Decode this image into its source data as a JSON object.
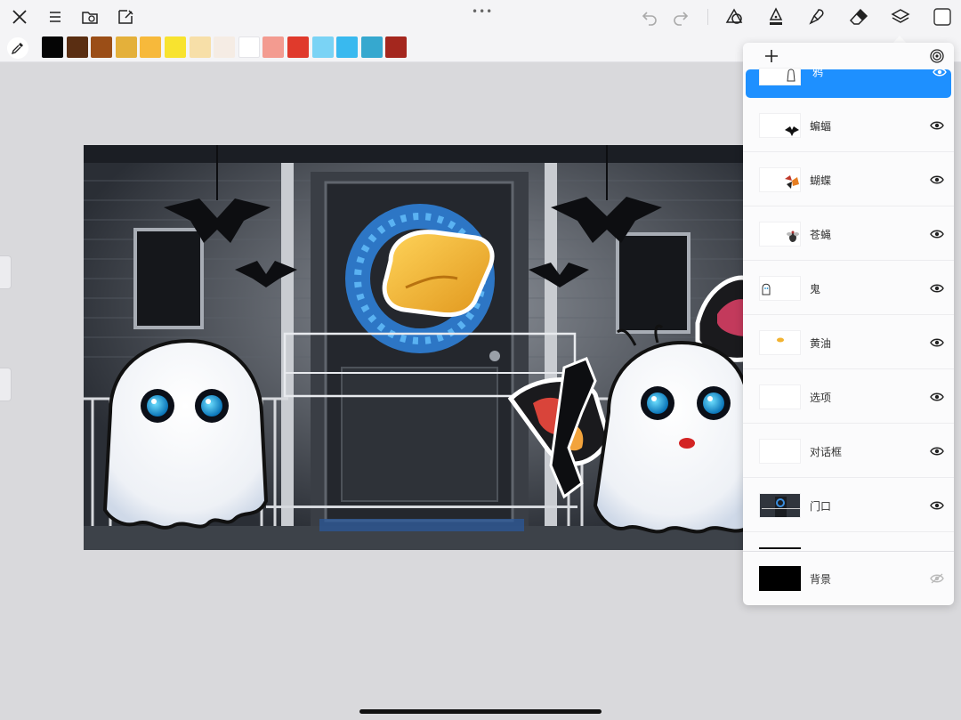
{
  "toolbar": {
    "left_icons": [
      "close-icon",
      "menu-icon",
      "gallery-folder-icon",
      "new-canvas-icon"
    ],
    "center_handle": "•••",
    "right_icons": [
      "undo-icon",
      "redo-icon",
      "shapes-icon",
      "pen-tool-icon",
      "smudge-brush-icon",
      "eraser-icon",
      "layers-icon",
      "color-square-icon"
    ]
  },
  "palette": {
    "tool": "eyedropper-icon",
    "colors": [
      "#050505",
      "#5a2e12",
      "#9b4e17",
      "#e4b03a",
      "#f7b93b",
      "#f8e32f",
      "#f7dfa8",
      "#f5ece4",
      "#ffffff",
      "#f39b90",
      "#e03a2c",
      "#7ad3f5",
      "#39b9ef",
      "#36a8cf",
      "#a4271e"
    ]
  },
  "layers_panel": {
    "add_icon": "add-layer-icon",
    "settings_icon": "spiral-icon",
    "layers": [
      {
        "name": "鸦",
        "visible": true,
        "selected": true
      },
      {
        "name": "蝙蝠",
        "visible": true,
        "selected": false
      },
      {
        "name": "蝴蝶",
        "visible": true,
        "selected": false
      },
      {
        "name": "苍蝇",
        "visible": true,
        "selected": false
      },
      {
        "name": "鬼",
        "visible": true,
        "selected": false
      },
      {
        "name": "黄油",
        "visible": true,
        "selected": false
      },
      {
        "name": "选项",
        "visible": true,
        "selected": false
      },
      {
        "name": "对话框",
        "visible": true,
        "selected": false
      },
      {
        "name": "门口",
        "visible": true,
        "selected": false
      },
      {
        "name": "背景",
        "visible": false,
        "selected": false
      }
    ]
  }
}
